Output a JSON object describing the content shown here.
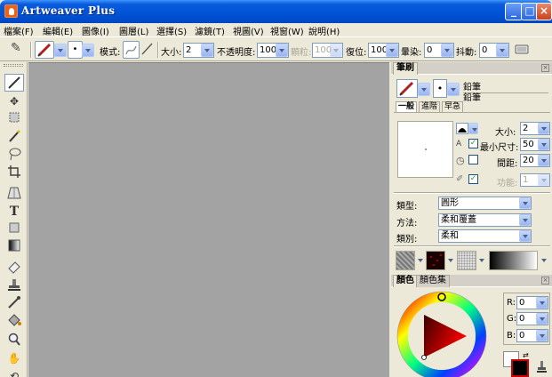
{
  "window": {
    "title": "Artweaver Plus"
  },
  "menu": [
    "檔案(F)",
    "編輯(E)",
    "圖像(I)",
    "圖層(L)",
    "選擇(S)",
    "濾鏡(T)",
    "視圖(V)",
    "視窗(W)",
    "說明(H)"
  ],
  "options": {
    "mode_label": "模式:",
    "size_label": "大小:",
    "size_value": "2",
    "opacity_label": "不透明度:",
    "opacity_value": "100",
    "grain_label": "顆粒:",
    "grain_value": "100",
    "recovery_label": "復位:",
    "recovery_value": "100",
    "bleed_label": "暈染:",
    "bleed_value": "0",
    "jitter_label": "抖動:",
    "jitter_value": "0"
  },
  "tools": [
    "pencil-tool",
    "move-tool",
    "rect-select-tool",
    "magic-wand-tool",
    "lasso-tool",
    "crop-tool",
    "perspective-tool",
    "text-tool",
    "shape-tool",
    "gradient-tool",
    "eraser-tool",
    "stamp-tool",
    "eyedropper-tool",
    "fill-tool",
    "zoom-tool",
    "hand-tool",
    "rotate-tool"
  ],
  "brush_panel": {
    "tab": "筆刷",
    "category": "鉛筆",
    "variant": "鉛筆",
    "subtabs": [
      "一般",
      "進階",
      "早急"
    ],
    "size_label": "大小:",
    "size_value": "2",
    "min_size_label": "最小尺寸:",
    "min_size_value": "50",
    "spacing_label": "間距:",
    "spacing_value": "20",
    "function_label": "功能:",
    "function_value": "1",
    "type_label": "類型:",
    "type_value": "圓形",
    "method_label": "方法:",
    "method_value": "柔和覆蓋",
    "class_label": "類別:",
    "class_value": "柔和"
  },
  "color_panel": {
    "tabs": [
      "顏色",
      "顏色集"
    ],
    "r_label": "R:",
    "r_value": "0",
    "g_label": "G:",
    "g_value": "0",
    "b_label": "B:",
    "b_value": "0",
    "foreground": "#000000",
    "background": "#ffffff"
  },
  "colors": {
    "title_blue": "#0052d6",
    "canvas_gray": "#a3a3a3",
    "panel_bg": "#ece9d8"
  }
}
